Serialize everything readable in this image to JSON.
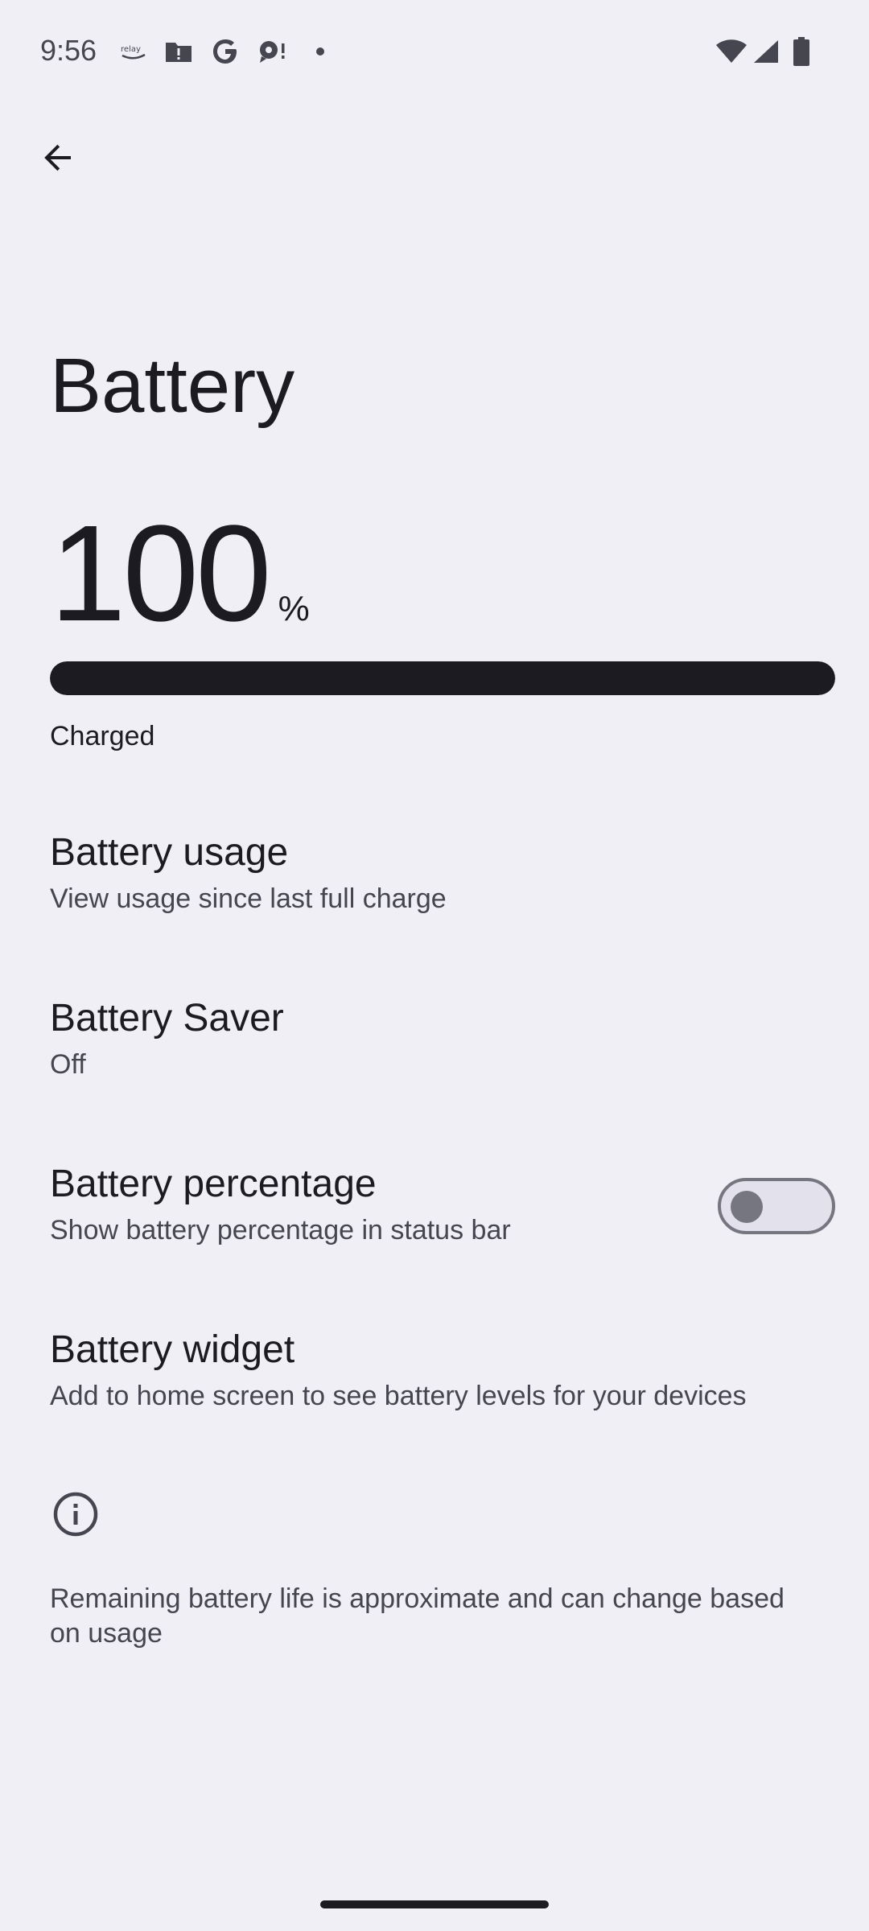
{
  "status_bar": {
    "time": "9:56",
    "notification_icons": [
      "relay-icon",
      "alert-folder-icon",
      "google-icon",
      "chat-bubble-icon",
      "dot-icon"
    ],
    "system_icons": [
      "wifi-icon",
      "cellular-signal-icon",
      "battery-icon"
    ]
  },
  "header": {
    "back_icon": "arrow-back-icon",
    "title": "Battery"
  },
  "battery": {
    "level": "100",
    "unit": "%",
    "level_fraction": 1.0,
    "status": "Charged"
  },
  "preferences": [
    {
      "title": "Battery usage",
      "summary": "View usage since last full charge"
    },
    {
      "title": "Battery Saver",
      "summary": "Off"
    },
    {
      "title": "Battery percentage",
      "summary": "Show battery percentage in status bar",
      "toggle_on": false
    },
    {
      "title": "Battery widget",
      "summary": "Add to home screen to see battery levels for your devices"
    }
  ],
  "footer": {
    "icon": "info-icon",
    "text": "Remaining battery life is approximate and can change based on usage"
  },
  "colors": {
    "background": "#f0eff6",
    "primary_text": "#1b1b21",
    "secondary_text": "#45464f",
    "toggle_outline": "#767680"
  }
}
